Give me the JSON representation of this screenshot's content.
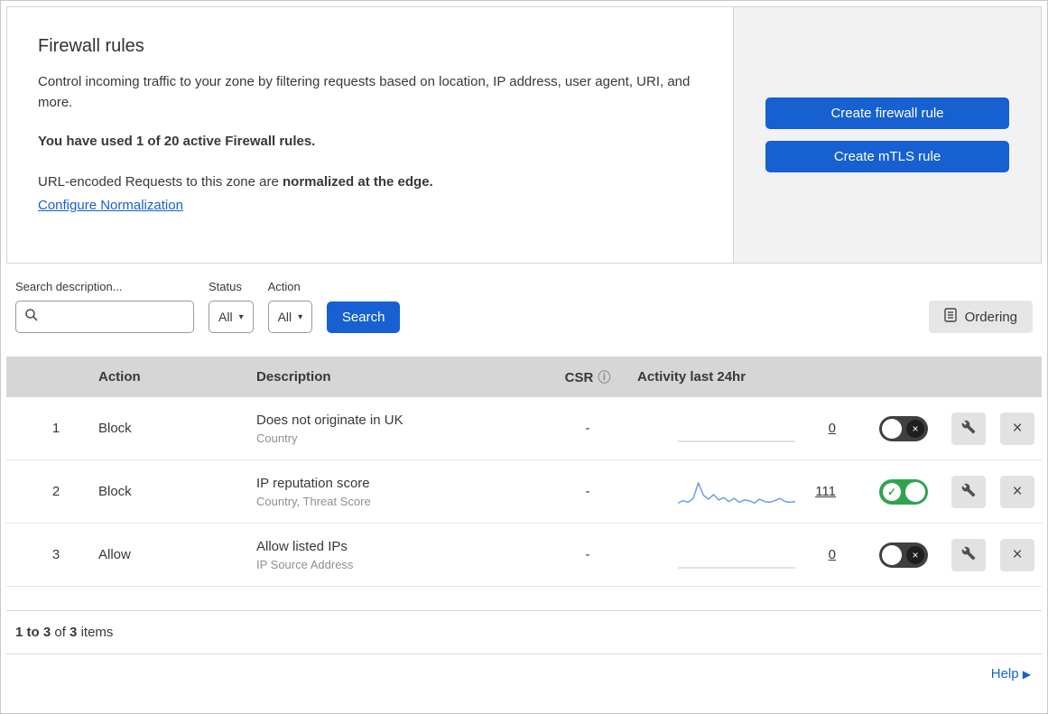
{
  "colors": {
    "accent_blue": "#1660d2",
    "link_blue": "#1660d2",
    "toggle_on_green": "#2ea44f",
    "toggle_off_gray": "#404040",
    "table_header_gray": "#d6d6d6",
    "side_panel_gray": "#f2f2f2",
    "sparkline_blue": "#6d9edd"
  },
  "icons": {
    "close": "×",
    "toggle_on": "✓",
    "toggle_off": "×",
    "dropdown": "▾",
    "info": "ⓘ",
    "help_arrow": "▶"
  },
  "header": {
    "title": "Firewall rules",
    "description": "Control incoming traffic to your zone by filtering requests based on location, IP address, user agent, URI, and more.",
    "usage": "You have used 1 of 20 active Firewall rules.",
    "normalization_prefix": "URL-encoded Requests to this zone are ",
    "normalization_bold": "normalized at the edge.",
    "normalization_link": "Configure Normalization",
    "create_firewall_rule": "Create firewall rule",
    "create_mtls_rule": "Create mTLS rule"
  },
  "filters": {
    "search_label": "Search description...",
    "search_value": "",
    "search_placeholder": "",
    "status_label": "Status",
    "status_value": "All",
    "action_label": "Action",
    "action_value": "All",
    "search_button": "Search",
    "ordering_button": "Ordering"
  },
  "table": {
    "headers": {
      "action": "Action",
      "description": "Description",
      "csr": "CSR",
      "activity": "Activity last 24hr"
    },
    "rows": [
      {
        "index": "1",
        "action": "Block",
        "description": "Does not originate in UK",
        "fields": "Country",
        "csr": "-",
        "activity_count": "0",
        "enabled": false,
        "sparkline": [
          0,
          0,
          0,
          0,
          0,
          0,
          0,
          0,
          0,
          0,
          0,
          0
        ]
      },
      {
        "index": "2",
        "action": "Block",
        "description": "IP reputation score",
        "fields": "Country, Threat Score",
        "csr": "-",
        "activity_count": "111",
        "enabled": true,
        "sparkline": [
          2,
          5,
          3,
          8,
          28,
          12,
          7,
          13,
          6,
          9,
          4,
          8,
          3,
          6,
          5,
          2,
          7,
          4,
          3,
          5,
          8,
          4,
          3,
          4
        ]
      },
      {
        "index": "3",
        "action": "Allow",
        "description": "Allow listed IPs",
        "fields": "IP Source Address",
        "csr": "-",
        "activity_count": "0",
        "enabled": false,
        "sparkline": [
          0,
          0,
          0,
          0,
          0,
          0,
          0,
          0,
          0,
          0,
          0,
          0
        ]
      }
    ]
  },
  "footer": {
    "range": "1 to 3",
    "of_text": "of",
    "total": "3",
    "items_text": "items",
    "help": "Help"
  }
}
